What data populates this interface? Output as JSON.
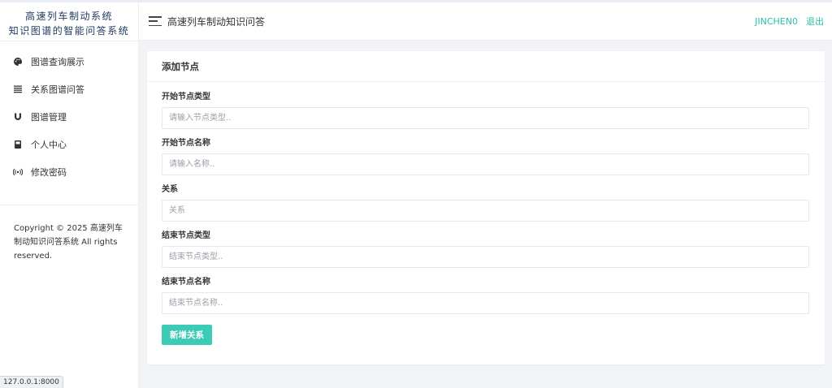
{
  "brand": {
    "line1": "高速列车制动系统",
    "line2": "知识图谱的智能问答系统"
  },
  "sidebar": {
    "items": [
      {
        "label": "图谱查询展示",
        "icon": "palette-icon"
      },
      {
        "label": "关系图谱问答",
        "icon": "list-icon"
      },
      {
        "label": "图谱管理",
        "icon": "magnet-icon"
      },
      {
        "label": "个人中心",
        "icon": "book-icon"
      },
      {
        "label": "修改密码",
        "icon": "broadcast-icon"
      }
    ],
    "copyright": "Copyright © 2025 高速列车制动知识问答系统 All rights reserved."
  },
  "header": {
    "title": "高速列车制动知识问答",
    "username": "JINCHEN0",
    "logout": "退出"
  },
  "card": {
    "title": "添加节点",
    "fields": [
      {
        "label": "开始节点类型",
        "placeholder": "请输入节点类型..",
        "value": ""
      },
      {
        "label": "开始节点名称",
        "placeholder": "请输入名称..",
        "value": ""
      },
      {
        "label": "关系",
        "placeholder": "关系",
        "value": ""
      },
      {
        "label": "结束节点类型",
        "placeholder": "结束节点类型..",
        "value": ""
      },
      {
        "label": "结束节点名称",
        "placeholder": "结束节点名称..",
        "value": ""
      }
    ],
    "submit_label": "新增关系"
  },
  "status_url": "127.0.0.1:8000",
  "colors": {
    "accent": "#3ccbb4",
    "header_link": "#2bbfa8",
    "brand_text": "#1f3a5f",
    "background": "#f1f3f6"
  }
}
